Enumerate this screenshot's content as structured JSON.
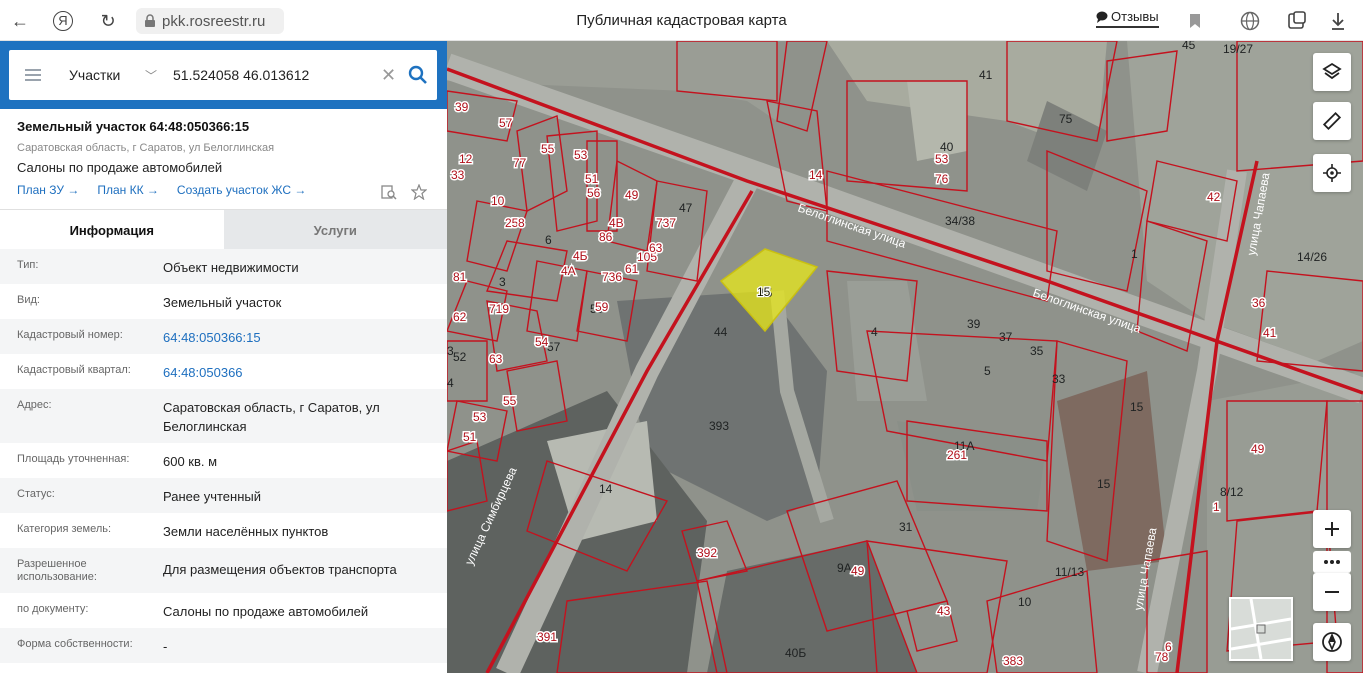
{
  "browser": {
    "url": "pkk.rosreestr.ru",
    "title": "Публичная кадастровая карта",
    "feedback": "Отзывы",
    "icons": [
      "back-icon",
      "yandex-icon",
      "reload-icon",
      "lock-icon",
      "bookmark-icon",
      "globe-icon",
      "collections-icon",
      "download-icon"
    ]
  },
  "search": {
    "type": "Участки",
    "value": "51.524058 46.013612"
  },
  "object": {
    "title": "Земельный участок 64:48:050366:15",
    "address": "Саратовская область, г Саратов, ул Белоглинская",
    "description": "Салоны по продаже автомобилей",
    "links": [
      "План ЗУ →",
      "План КК →",
      "Создать участок ЖС →"
    ]
  },
  "tabs": [
    {
      "label": "Информация"
    },
    {
      "label": "Услуги"
    }
  ],
  "info": [
    {
      "label": "Тип:",
      "value": "Объект недвижимости"
    },
    {
      "label": "Вид:",
      "value": "Земельный участок"
    },
    {
      "label": "Кадастровый номер:",
      "value": "64:48:050366:15"
    },
    {
      "label": "Кадастровый квартал:",
      "value": "64:48:050366"
    },
    {
      "label": "Адрес:",
      "value": "Саратовская область, г Саратов, ул Белоглинская"
    },
    {
      "label": "Площадь уточненная:",
      "value": "600 кв. м"
    },
    {
      "label": "Статус:",
      "value": "Ранее учтенный"
    },
    {
      "label": "Категория земель:",
      "value": "Земли населённых пунктов"
    },
    {
      "label": "Разрешенное использование:",
      "value": "Для размещения объектов транспорта"
    },
    {
      "label": "по документу:",
      "value": "Салоны по продаже автомобилей"
    },
    {
      "label": "Форма собственности:",
      "value": "-"
    }
  ],
  "map": {
    "streets": [
      "Белоглинская улица",
      "Белоглинская улица",
      "улица Симбирцева",
      "улица Чапаева",
      "улица Чапаева"
    ],
    "parcel_labels_red": [
      "39",
      "57",
      "55",
      "77",
      "53",
      "12",
      "33",
      "10",
      "25",
      "8",
      "51",
      "56",
      "49",
      "737",
      "4В",
      "86",
      "105",
      "63",
      "61",
      "4Б",
      "736",
      "4А",
      "59",
      "81",
      "719",
      "63",
      "54",
      "62",
      "53",
      "55",
      "51",
      "392",
      "391",
      "383",
      "76",
      "53",
      "42",
      "14",
      "36",
      "41",
      "43",
      "49",
      "78",
      "49",
      "261",
      "1",
      "6"
    ],
    "parcel_labels_dark": [
      "41",
      "45",
      "19/27",
      "75",
      "40",
      "34/38",
      "1",
      "14/26",
      "47",
      "6",
      "3",
      "59",
      "44",
      "15",
      "4",
      "39",
      "37",
      "35",
      "33",
      "5",
      "15",
      "11А",
      "15",
      "8/12",
      "393",
      "14",
      "31",
      "9А",
      "11/13",
      "10",
      "40Б",
      "57",
      "3",
      "4",
      "52"
    ],
    "highlighted_parcel": "15",
    "controls": [
      "layers-icon",
      "ruler-icon",
      "locate-icon",
      "zoom-in-icon",
      "more-icon",
      "zoom-out-icon",
      "compass-icon"
    ],
    "colors": {
      "boundary": "#c4121e",
      "highlight": "#e8e81a",
      "base": "#8f928b"
    }
  }
}
